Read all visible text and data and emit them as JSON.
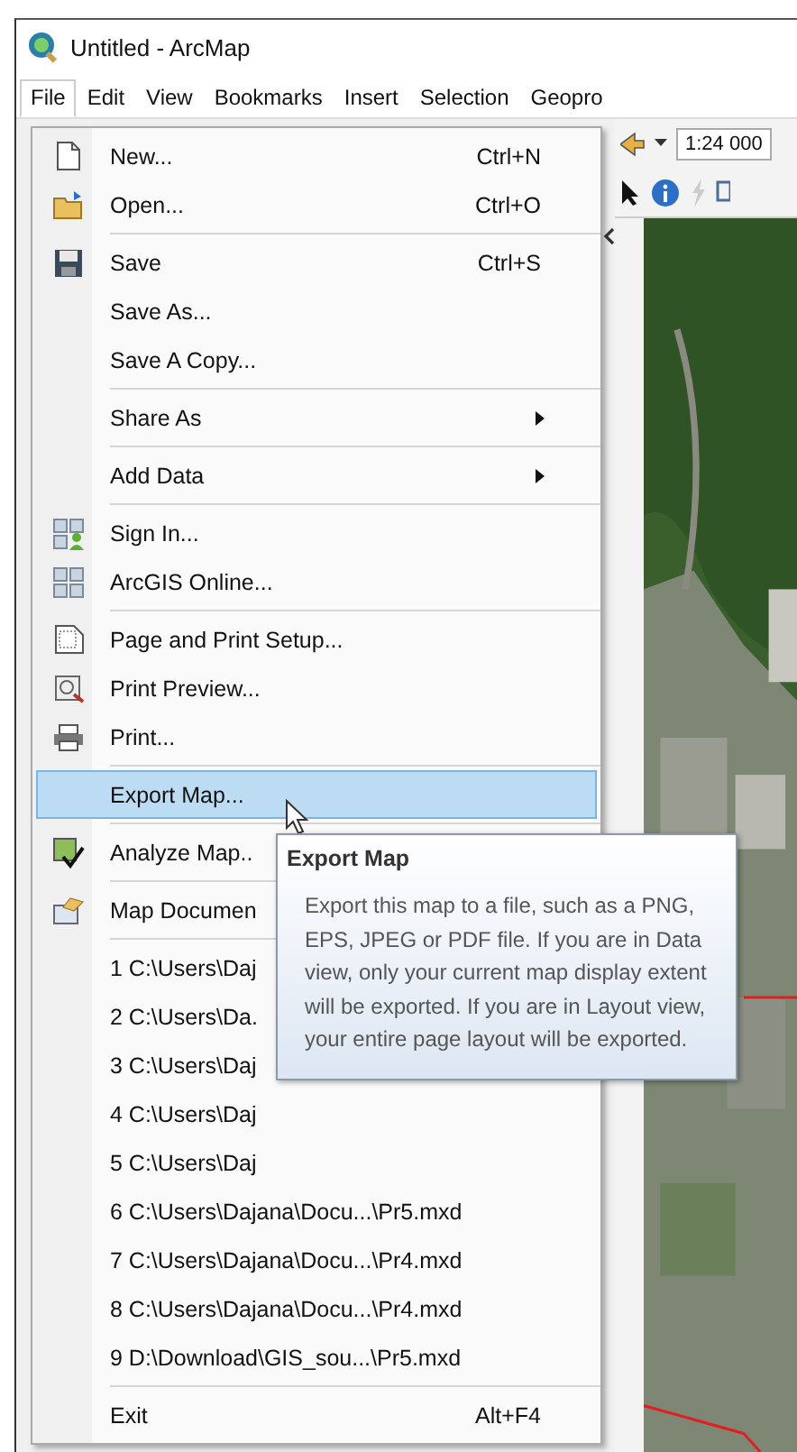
{
  "window": {
    "title": "Untitled - ArcMap"
  },
  "menubar": [
    {
      "label": "File",
      "selected": true
    },
    {
      "label": "Edit",
      "selected": false
    },
    {
      "label": "View",
      "selected": false
    },
    {
      "label": "Bookmarks",
      "selected": false
    },
    {
      "label": "Insert",
      "selected": false
    },
    {
      "label": "Selection",
      "selected": false
    },
    {
      "label": "Geopro",
      "selected": false
    }
  ],
  "toolbar": {
    "scale_field": "1:24 000"
  },
  "file_menu": {
    "sections": [
      [
        {
          "kind": "command",
          "label": "New...",
          "shortcut": "Ctrl+N",
          "selected": false
        },
        {
          "kind": "command",
          "label": "Open...",
          "shortcut": "Ctrl+O",
          "selected": false
        }
      ],
      [
        {
          "kind": "command",
          "label": "Save",
          "shortcut": "Ctrl+S",
          "selected": false
        },
        {
          "kind": "command",
          "label": "Save As...",
          "selected": false
        },
        {
          "kind": "command",
          "label": "Save A Copy...",
          "selected": false
        }
      ],
      [
        {
          "kind": "submenu",
          "label": "Share As",
          "selected": false
        }
      ],
      [
        {
          "kind": "submenu",
          "label": "Add Data",
          "selected": false
        }
      ],
      [
        {
          "kind": "command",
          "label": "Sign In...",
          "selected": false
        },
        {
          "kind": "command",
          "label": "ArcGIS Online...",
          "selected": false
        }
      ],
      [
        {
          "kind": "command",
          "label": "Page and Print Setup...",
          "selected": false
        },
        {
          "kind": "command",
          "label": "Print Preview...",
          "selected": false
        },
        {
          "kind": "command",
          "label": "Print...",
          "selected": false
        }
      ],
      [
        {
          "kind": "command",
          "label": "Export Map...",
          "selected": true
        }
      ],
      [
        {
          "kind": "command",
          "label": "Analyze Map..",
          "selected": false
        }
      ],
      [
        {
          "kind": "command",
          "label": "Map Documen",
          "selected": false
        }
      ],
      [
        {
          "kind": "command",
          "label": "1 C:\\Users\\Daj",
          "selected": false
        },
        {
          "kind": "command",
          "label": "2 C:\\Users\\Da.",
          "selected": false
        },
        {
          "kind": "command",
          "label": "3 C:\\Users\\Daj",
          "selected": false
        },
        {
          "kind": "command",
          "label": "4 C:\\Users\\Daj",
          "selected": false
        },
        {
          "kind": "command",
          "label": "5 C:\\Users\\Daj",
          "selected": false
        },
        {
          "kind": "command",
          "label": "6 C:\\Users\\Dajana\\Docu...\\Pr5.mxd",
          "selected": false
        },
        {
          "kind": "command",
          "label": "7 C:\\Users\\Dajana\\Docu...\\Pr4.mxd",
          "selected": false
        },
        {
          "kind": "command",
          "label": "8 C:\\Users\\Dajana\\Docu...\\Pr4.mxd",
          "selected": false
        },
        {
          "kind": "command",
          "label": "9 D:\\Download\\GIS_sou...\\Pr5.mxd",
          "selected": false
        }
      ],
      [
        {
          "kind": "command",
          "label": "Exit",
          "shortcut": "Alt+F4",
          "selected": false
        }
      ]
    ]
  },
  "tooltip": {
    "title": "Export Map",
    "text": "Export this map to a file, such as a PNG, EPS, JPEG or PDF file. If you are in Data view, only your current map display extent will be exported. If you are in Layout view, your entire page layout will be exported."
  }
}
